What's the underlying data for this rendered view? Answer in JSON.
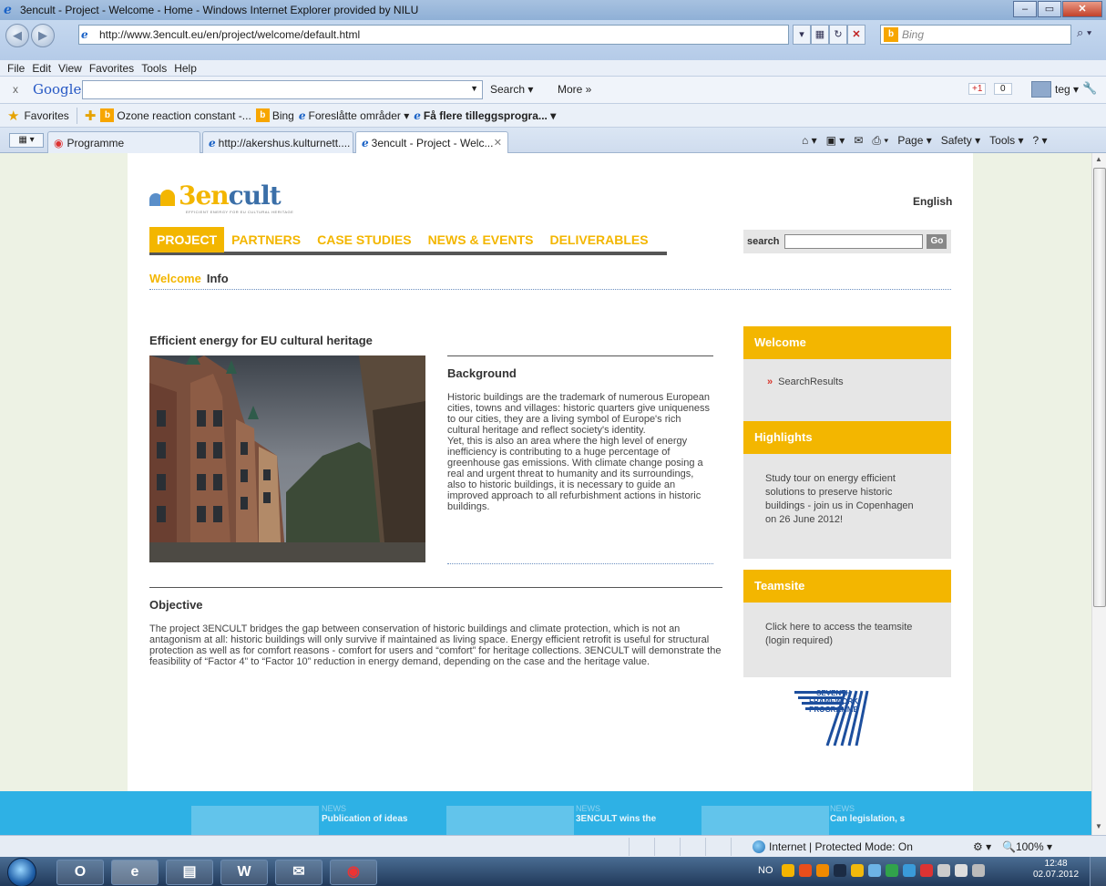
{
  "window": {
    "title": "3encult - Project - Welcome - Home - Windows Internet Explorer provided by NILU",
    "minimize": "–",
    "maximize": "▭",
    "close": "✕"
  },
  "address": {
    "url": "http://www.3encult.eu/en/project/welcome/default.html",
    "search_placeholder": "Bing"
  },
  "menubar": [
    "File",
    "Edit",
    "View",
    "Favorites",
    "Tools",
    "Help"
  ],
  "googlebar": {
    "close": "x",
    "logo": "Google",
    "search_label": "Search ▾",
    "more_label": "More »",
    "plusone": "+1",
    "count": "0",
    "user": "teg ▾"
  },
  "favorites": {
    "label": "Favorites",
    "items": [
      "Ozone reaction constant -...",
      "Bing",
      "Foreslåtte områder ▾",
      "Få flere tilleggsprogra... ▾"
    ]
  },
  "tabs": {
    "group": "Programme",
    "tab1": "http://akershus.kulturnett....",
    "tab2": "3encult - Project - Welc...",
    "close": "✕"
  },
  "commandbar": [
    "⌂ ▾",
    "▣ ▾",
    "✉",
    "⎙ ▾",
    "Page ▾",
    "Safety ▾",
    "Tools ▾",
    "? ▾"
  ],
  "site": {
    "logo_a": "3en",
    "logo_b": "cult",
    "logo_tag": "EFFICIENT ENERGY FOR EU CULTURAL HERITAGE",
    "language": "English",
    "nav": [
      "PROJECT",
      "PARTNERS",
      "CASE STUDIES",
      "NEWS & EVENTS",
      "DELIVERABLES"
    ],
    "search_label": "search",
    "search_button": "Go",
    "subnav": [
      "Welcome",
      "Info"
    ],
    "intro_title": "Efficient energy for EU cultural heritage",
    "background_title": "Background",
    "background_p1": "Historic buildings are the trademark of numerous European cities, towns and villages: historic quarters give uniqueness to our cities, they are a living symbol of Europe's rich cultural heritage and reflect society's identity.",
    "background_p2": "Yet, this is also an area where the high level of energy inefficiency is contributing to a huge percentage of greenhouse gas emissions. With climate change posing a real and urgent threat to humanity and its surroundings, also to historic buildings, it is necessary to guide an improved approach to all refurbishment actions in historic buildings.",
    "objective_title": "Objective",
    "objective_text": "The project 3ENCULT bridges the gap between conservation of historic buildings and climate protection, which is not an antagonism at all: historic buildings will only survive if maintained as living space. Energy efficient retrofit is useful for structural protection as well as for comfort reasons - comfort for users and “comfort” for heritage collections. 3ENCULT will demonstrate the feasibility of “Factor 4” to “Factor 10” reduction in energy demand, depending on the case and the heritage value.",
    "sidebar": {
      "welcome_title": "Welcome",
      "welcome_link": "SearchResults",
      "highlights_title": "Highlights",
      "highlights_text": "Study tour on energy efficient solutions to preserve historic buildings - join us in Copenhagen on 26 June 2012!",
      "teamsite_title": "Teamsite",
      "teamsite_text": "Click here to access the teamsite (login required)"
    },
    "fp7_line1": "SEVENTH FRAMEWORK",
    "fp7_line2": "PROGRAMME",
    "news": [
      {
        "label": "NEWS",
        "title": "Publication of ideas"
      },
      {
        "label": "NEWS",
        "title": "3ENCULT wins the"
      },
      {
        "label": "NEWS",
        "title": "Can legislation, s"
      }
    ]
  },
  "statusbar": {
    "zone": "Internet | Protected Mode: On",
    "zoom": "🔍100% ▾"
  },
  "taskbar": {
    "lang": "NO",
    "time": "12:48",
    "date": "02.07.2012"
  },
  "colors": {
    "brand_yellow": "#f3b600",
    "brand_blue": "#3b6fa8",
    "news_strip": "#2eb1e5"
  }
}
